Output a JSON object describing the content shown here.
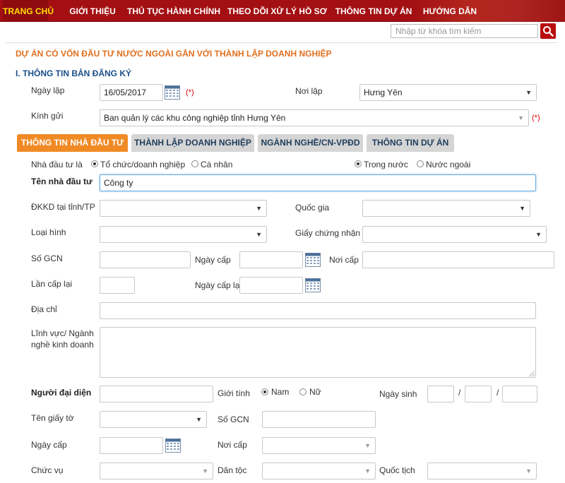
{
  "nav": {
    "items": [
      {
        "label": "TRANG CHỦ"
      },
      {
        "label": "GIỚI THIỆU"
      },
      {
        "label": "THỦ TỤC HÀNH CHÍNH"
      },
      {
        "label": "THEO DÕI XỬ LÝ HỒ SƠ"
      },
      {
        "label": "THÔNG TIN DỰ ÁN"
      },
      {
        "label": "HƯỚNG DẪN"
      }
    ],
    "colors": {
      "background": "#a30f12",
      "active_text": "#ffe000"
    }
  },
  "search": {
    "placeholder": "Nhập từ khóa tìm kiếm",
    "icon": "search-icon"
  },
  "page": {
    "title": "DỰ ÁN CÓ VỐN ĐẦU TƯ NƯỚC NGOÀI GẮN VỚI THÀNH LẬP DOANH NGHIỆP",
    "section": "I. THÔNG TIN BẢN ĐĂNG KÝ"
  },
  "registration": {
    "date_label": "Ngày lập",
    "date_value": "16/05/2017",
    "required_mark": "(*)",
    "place_label": "Nơi lập",
    "place_value": "Hưng Yên",
    "recipient_label": "Kính gửi",
    "recipient_value": "Ban quản lý các khu công nghiệp tỉnh Hưng Yên"
  },
  "tabs": [
    {
      "label": "THÔNG TIN NHÀ ĐẦU TƯ",
      "active": true
    },
    {
      "label": "THÀNH LẬP DOANH NGHIỆP",
      "active": false
    },
    {
      "label": "NGÀNH NGHỀ/CN-VPĐD",
      "active": false
    },
    {
      "label": "THÔNG TIN DỰ ÁN",
      "active": false
    }
  ],
  "investor": {
    "type_label": "Nhà đầu tư là",
    "type_options": [
      "Tổ chức/doanh nghiệp",
      "Cá nhân"
    ],
    "type_selected": "Tổ chức/doanh nghiệp",
    "origin_options": [
      "Trong nước",
      "Nước ngoài"
    ],
    "origin_selected": "Trong nước",
    "name_label": "Tên nhà đầu tư",
    "name_value": "Công ty",
    "province_label": "ĐKKD tại tỉnh/TP",
    "country_label": "Quốc gia",
    "type2_label": "Loại hình",
    "certificate_label": "Giấy chứng nhận",
    "cert_no_label": "Số GCN",
    "issue_date_label": "Ngày cấp",
    "issue_place_label": "Nơi cấp",
    "reissue_label": "Lần cấp lại",
    "reissue_date_label": "Ngày cấp lại",
    "address_label": "Địa chỉ",
    "field_label_line1": "Lĩnh vực/ Ngành",
    "field_label_line2": "nghề kinh doanh"
  },
  "representative": {
    "label": "Người đại diện",
    "gender_label": "Giới tính",
    "gender_options": [
      "Nam",
      "Nữ"
    ],
    "gender_selected": "Nam",
    "dob_label": "Ngày sinh",
    "date_separator": "/",
    "doc_label": "Tên giấy tờ",
    "doc_no_label": "Số GCN",
    "issue_date_label": "Ngày cấp",
    "issue_place_label": "Nơi cấp",
    "position_label": "Chức vụ",
    "ethnicity_label": "Dân tộc",
    "nationality_label": "Quốc tịch"
  }
}
